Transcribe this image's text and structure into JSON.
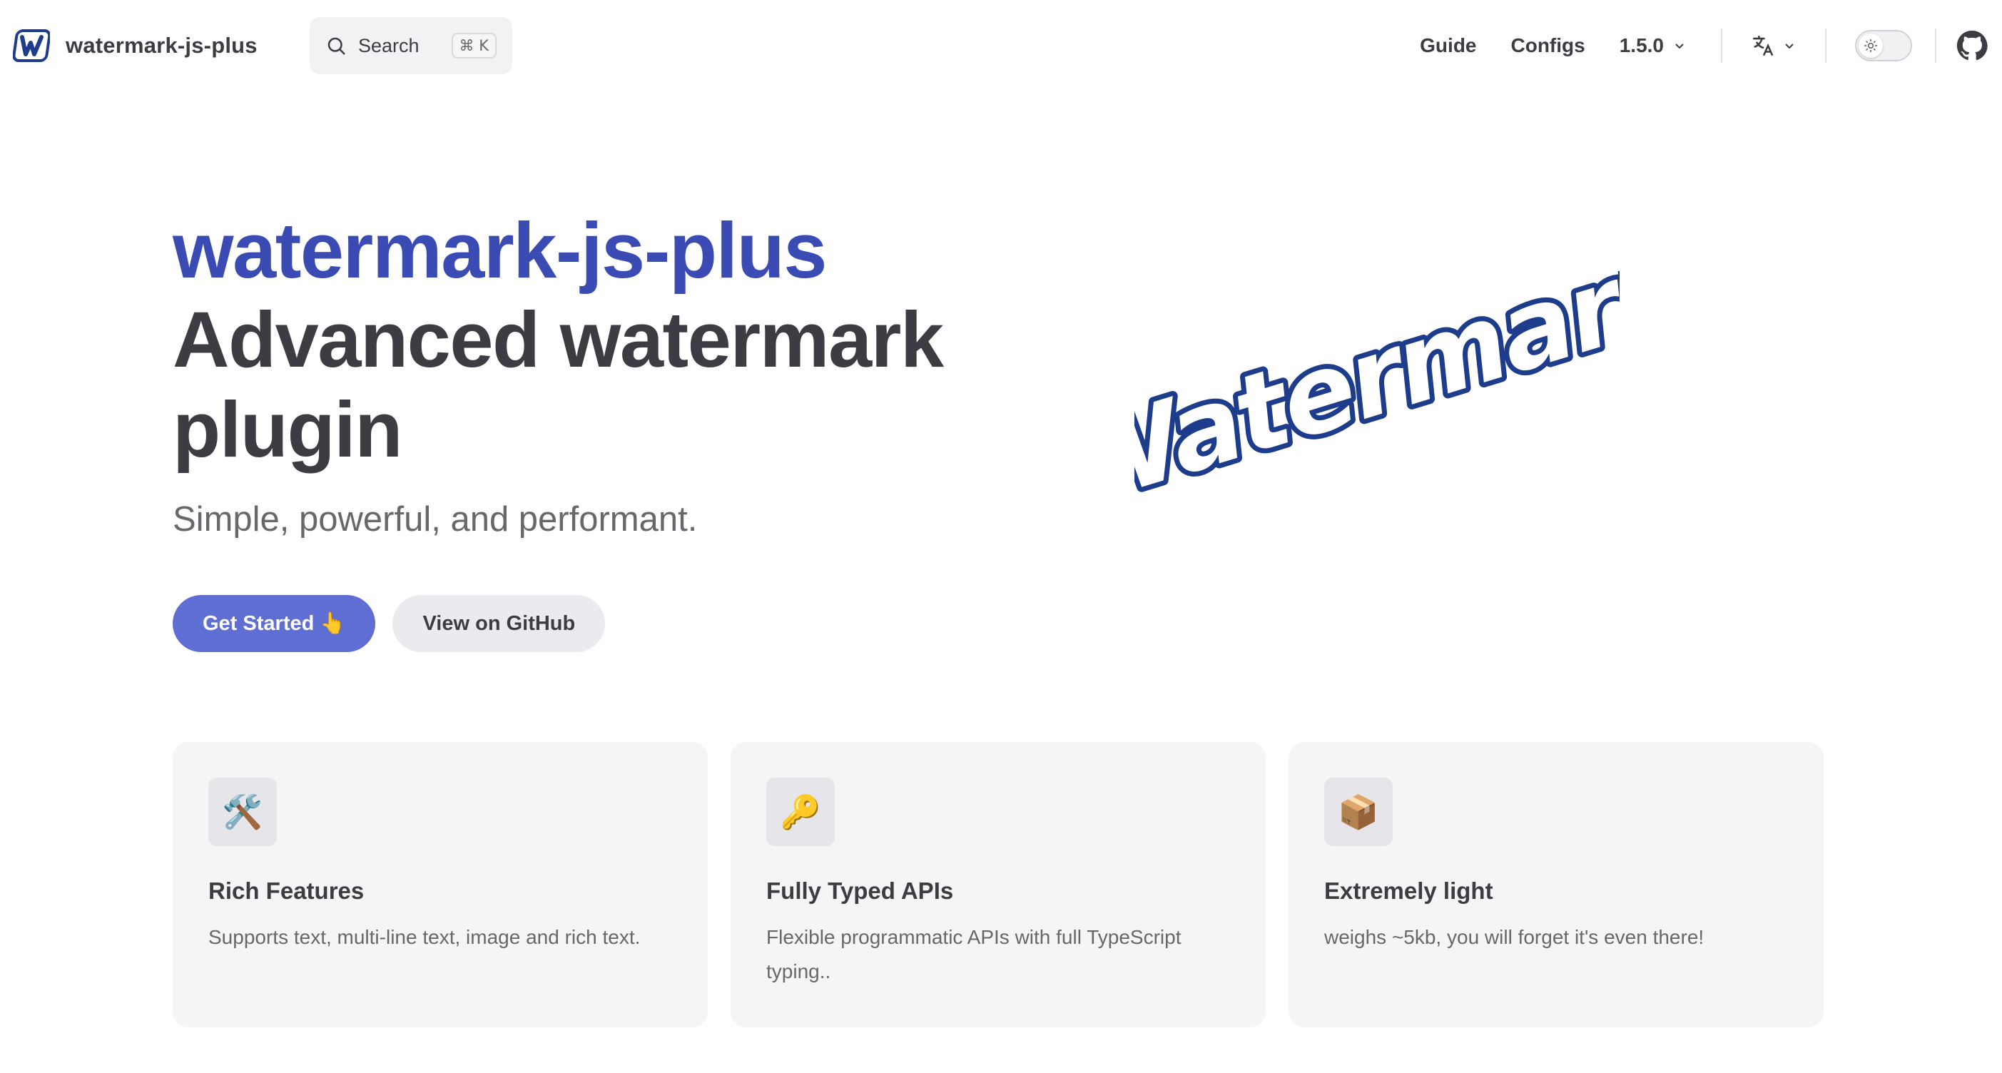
{
  "nav": {
    "title": "watermark-js-plus",
    "search_label": "Search",
    "search_shortcut": "⌘ K",
    "links": [
      "Guide",
      "Configs"
    ],
    "version": "1.5.0",
    "icons": {
      "logo": "watermark-logo-icon",
      "search": "search-icon",
      "translate": "translate-icon",
      "theme": "sun-icon",
      "github": "github-icon",
      "chevron": "chevron-down-icon"
    }
  },
  "hero": {
    "name": "watermark-js-plus",
    "text": "Advanced watermark plugin",
    "tagline": "Simple, powerful, and performant.",
    "image_text": "Watermark",
    "actions": {
      "primary": "Get Started 👆",
      "secondary": "View on GitHub"
    }
  },
  "features": [
    {
      "icon": "🛠️",
      "title": "Rich Features",
      "details": "Supports text, multi-line text, image and rich text."
    },
    {
      "icon": "🔑",
      "title": "Fully Typed APIs",
      "details": "Flexible programmatic APIs with full TypeScript typing.."
    },
    {
      "icon": "📦",
      "title": "Extremely light",
      "details": "weighs ~5kb, you will forget it's even there!"
    }
  ],
  "colors": {
    "brand": "#3a4bb3",
    "button": "#5f6ed2",
    "logo_blue": "#1e3c8c"
  }
}
